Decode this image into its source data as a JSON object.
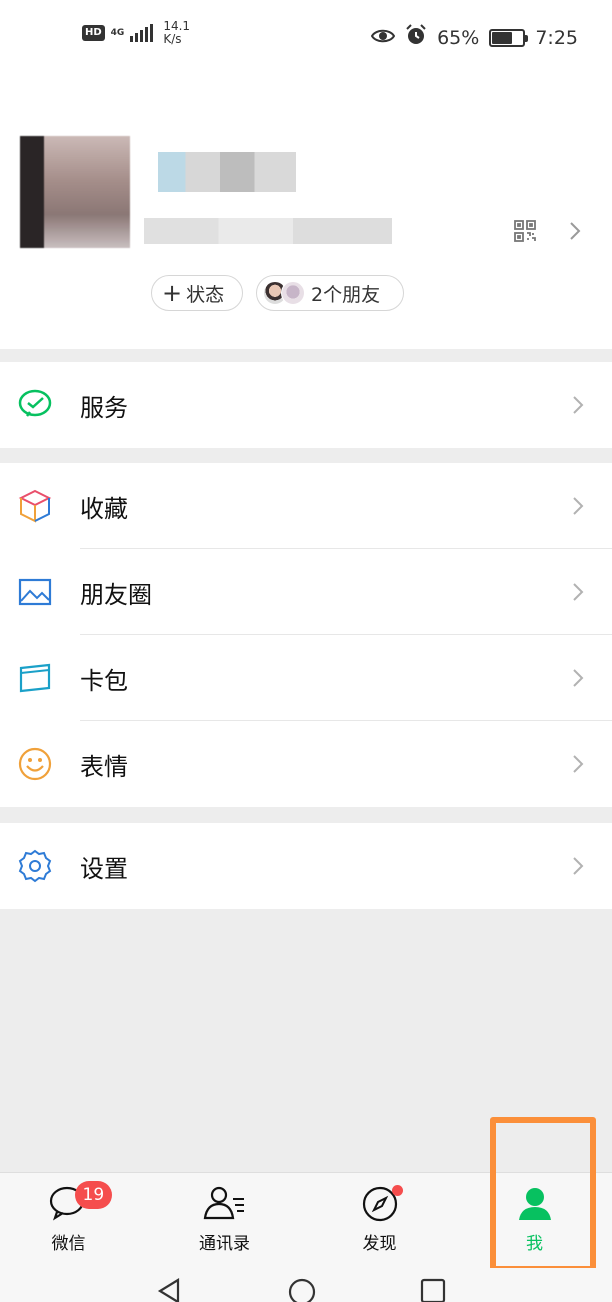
{
  "status_bar": {
    "hd": "HD",
    "network": "4G",
    "speed_value": "14.1",
    "speed_unit": "K/s",
    "battery": "65%",
    "battery_level": 0.65,
    "time": "7:25",
    "icons": [
      "eye-icon",
      "alarm-icon",
      "battery-icon"
    ]
  },
  "profile": {
    "status_button": "状态",
    "friends_button": "2个朋友"
  },
  "menu": {
    "services": {
      "label": "服务",
      "icon": "wechat-pay-icon",
      "color": "#07c160"
    },
    "favorites": {
      "label": "收藏",
      "icon": "cube-icon"
    },
    "moments": {
      "label": "朋友圈",
      "icon": "picture-icon",
      "color": "#2e7bd6"
    },
    "cards": {
      "label": "卡包",
      "icon": "card-icon",
      "color": "#1aa0c8"
    },
    "stickers": {
      "label": "表情",
      "icon": "smiley-icon",
      "color": "#f0a13a"
    },
    "settings": {
      "label": "设置",
      "icon": "gear-icon",
      "color": "#2e7bd6"
    }
  },
  "tabbar": {
    "chats": {
      "label": "微信",
      "badge": "19"
    },
    "contacts": {
      "label": "通讯录"
    },
    "discover": {
      "label": "发现"
    },
    "me": {
      "label": "我",
      "active_color": "#07c160"
    }
  },
  "colors": {
    "accent": "#07c160",
    "badge": "#f54d4d",
    "highlight": "#fb8f3a"
  }
}
